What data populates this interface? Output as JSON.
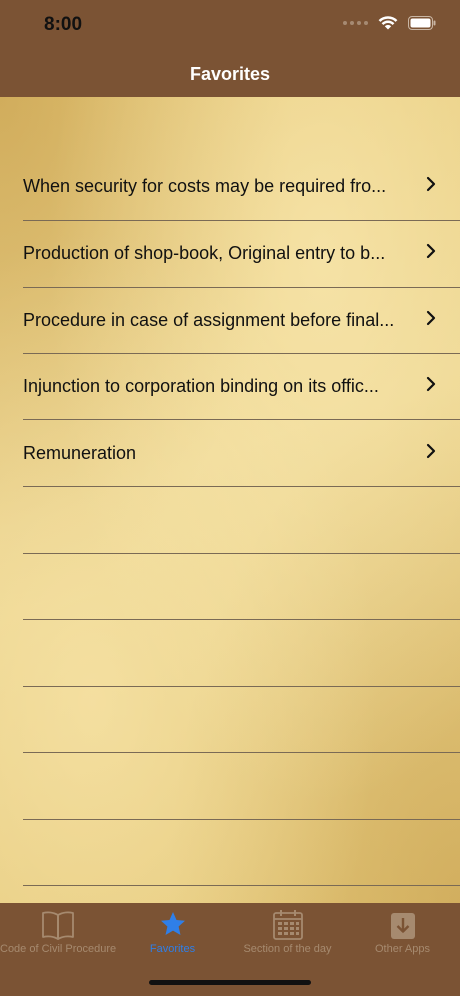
{
  "status": {
    "time": "8:00"
  },
  "nav": {
    "title": "Favorites"
  },
  "favorites": [
    {
      "label": "When security for costs may be required fro..."
    },
    {
      "label": "Production of shop-book, Original entry to b..."
    },
    {
      "label": "Procedure in case of assignment before final..."
    },
    {
      "label": "Injunction to corporation binding on its offic..."
    },
    {
      "label": "Remuneration"
    }
  ],
  "tabs": [
    {
      "label": "Code of Civil Procedure",
      "icon": "book-icon",
      "active": false
    },
    {
      "label": "Favorites",
      "icon": "star-icon",
      "active": true
    },
    {
      "label": "Section of the day",
      "icon": "calendar-icon",
      "active": false
    },
    {
      "label": "Other Apps",
      "icon": "download-icon",
      "active": false
    }
  ],
  "colors": {
    "bar": "#7b5334",
    "active_tab": "#2f7fe8",
    "inactive_tab": "#a68a6f"
  }
}
